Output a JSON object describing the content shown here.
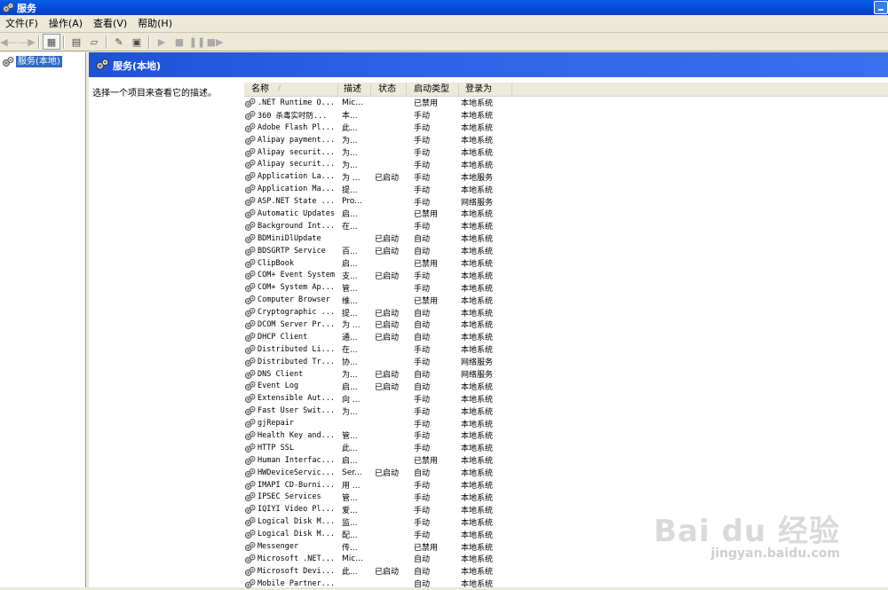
{
  "window": {
    "title": "服务"
  },
  "menu": [
    "文件(F)",
    "操作(A)",
    "查看(V)",
    "帮助(H)"
  ],
  "toolbar": {
    "buttons": [
      "back",
      "forward",
      "show-hide-tree",
      "properties",
      "refresh",
      "export-list",
      "help",
      "view-toggle",
      "start",
      "stop",
      "pause",
      "restart"
    ]
  },
  "tree": {
    "root_label": "服务(本地)"
  },
  "pane": {
    "title": "服务(本地)",
    "description_hint": "选择一个项目来查看它的描述。"
  },
  "list": {
    "columns": [
      "名称",
      "描述",
      "状态",
      "启动类型",
      "登录为"
    ],
    "sort_indicator": "/",
    "rows": [
      [
        ".NET Runtime O...",
        "Mic...",
        "",
        "已禁用",
        "本地系统"
      ],
      [
        "360 杀毒实时防...",
        "本...",
        "",
        "手动",
        "本地系统"
      ],
      [
        "Adobe Flash Pl...",
        "此...",
        "",
        "手动",
        "本地系统"
      ],
      [
        "Alipay payment...",
        "为...",
        "",
        "手动",
        "本地系统"
      ],
      [
        "Alipay securit...",
        "为...",
        "",
        "手动",
        "本地系统"
      ],
      [
        "Alipay securit...",
        "为...",
        "",
        "手动",
        "本地系统"
      ],
      [
        "Application La...",
        "为 ...",
        "已启动",
        "手动",
        "本地服务"
      ],
      [
        "Application Ma...",
        "提...",
        "",
        "手动",
        "本地系统"
      ],
      [
        "ASP.NET State ...",
        "Pro...",
        "",
        "手动",
        "网络服务"
      ],
      [
        "Automatic Updates",
        "启...",
        "",
        "已禁用",
        "本地系统"
      ],
      [
        "Background Int...",
        "在...",
        "",
        "手动",
        "本地系统"
      ],
      [
        "BDMiniDlUpdate",
        "",
        "已启动",
        "自动",
        "本地系统"
      ],
      [
        "BDSGRTP Service",
        "百...",
        "已启动",
        "自动",
        "本地系统"
      ],
      [
        "ClipBook",
        "启...",
        "",
        "已禁用",
        "本地系统"
      ],
      [
        "COM+ Event System",
        "支...",
        "已启动",
        "手动",
        "本地系统"
      ],
      [
        "COM+ System Ap...",
        "管...",
        "",
        "手动",
        "本地系统"
      ],
      [
        "Computer Browser",
        "维...",
        "",
        "已禁用",
        "本地系统"
      ],
      [
        "Cryptographic ...",
        "提...",
        "已启动",
        "自动",
        "本地系统"
      ],
      [
        "DCOM Server Pr...",
        "为 ...",
        "已启动",
        "自动",
        "本地系统"
      ],
      [
        "DHCP Client",
        "通...",
        "已启动",
        "自动",
        "本地系统"
      ],
      [
        "Distributed Li...",
        "在...",
        "",
        "手动",
        "本地系统"
      ],
      [
        "Distributed Tr...",
        "协...",
        "",
        "手动",
        "网络服务"
      ],
      [
        "DNS Client",
        "为...",
        "已启动",
        "自动",
        "网络服务"
      ],
      [
        "Event Log",
        "启...",
        "已启动",
        "自动",
        "本地系统"
      ],
      [
        "Extensible Aut...",
        "向 ...",
        "",
        "手动",
        "本地系统"
      ],
      [
        "Fast User Swit...",
        "为...",
        "",
        "手动",
        "本地系统"
      ],
      [
        "gjRepair",
        "",
        "",
        "手动",
        "本地系统"
      ],
      [
        "Health Key and...",
        "管...",
        "",
        "手动",
        "本地系统"
      ],
      [
        "HTTP SSL",
        "此...",
        "",
        "手动",
        "本地系统"
      ],
      [
        "Human Interfac...",
        "启...",
        "",
        "已禁用",
        "本地系统"
      ],
      [
        "HWDeviceServic...",
        "Ser...",
        "已启动",
        "自动",
        "本地系统"
      ],
      [
        "IMAPI CD-Burni...",
        "用 ...",
        "",
        "手动",
        "本地系统"
      ],
      [
        "IPSEC Services",
        "管...",
        "",
        "手动",
        "本地系统"
      ],
      [
        "IQIYI Video Pl...",
        "爱...",
        "",
        "手动",
        "本地系统"
      ],
      [
        "Logical Disk M...",
        "监...",
        "",
        "手动",
        "本地系统"
      ],
      [
        "Logical Disk M...",
        "配...",
        "",
        "手动",
        "本地系统"
      ],
      [
        "Messenger",
        "传...",
        "",
        "已禁用",
        "本地系统"
      ],
      [
        "Microsoft .NET...",
        "Mic...",
        "",
        "自动",
        "本地系统"
      ],
      [
        "Microsoft Devi...",
        "此...",
        "已启动",
        "自动",
        "本地系统"
      ],
      [
        "Mobile Partner...",
        "",
        "",
        "自动",
        "本地系统"
      ]
    ]
  },
  "watermark": {
    "main": "Bai du 经验",
    "sub": "jingyan.baidu.com"
  },
  "colors": {
    "title_bar": "#0a5fe6",
    "pane_header": "#2d63e6",
    "selection": "#316ac5",
    "chrome": "#ece9d8"
  }
}
